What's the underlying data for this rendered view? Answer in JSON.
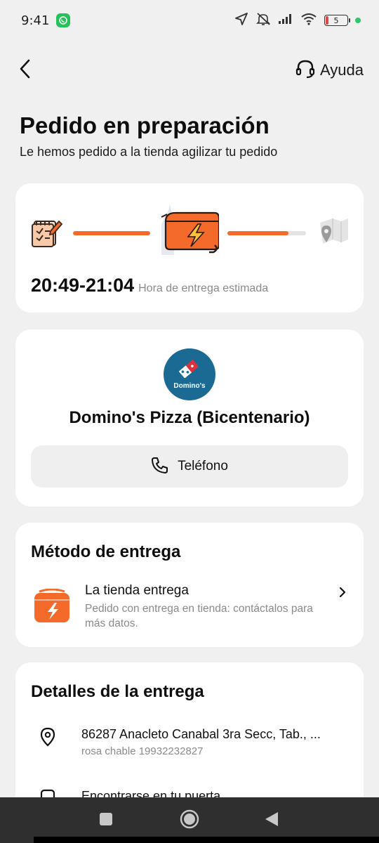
{
  "status_bar": {
    "time": "9:41",
    "battery": "5",
    "icons": [
      "whatsapp-icon",
      "location-arrow-icon",
      "mute-icon",
      "signal-icon",
      "wifi-icon",
      "battery-icon"
    ]
  },
  "header": {
    "back_icon": "chevron-left-icon",
    "help_label": "Ayuda",
    "help_icon": "headset-icon"
  },
  "title": "Pedido en preparación",
  "subtitle": "Le hemos pedido a la tienda agilizar tu pedido",
  "progress": {
    "steps": [
      "order-notepad-icon",
      "delivery-bag-icon",
      "map-pin-icon"
    ],
    "segment_1_fill": 1.0,
    "segment_2_fill": 0.78,
    "eta_time": "20:49-21:04",
    "eta_label": "Hora de entrega estimada",
    "accent": "#f36a2a"
  },
  "store": {
    "logo_text": "Domino's",
    "logo_color": "#1a6a94",
    "name": "Domino's Pizza (Bicentenario)",
    "phone_label": "Teléfono"
  },
  "delivery_method": {
    "heading": "Método de entrega",
    "title": "La tienda entrega",
    "description": "Pedido con entrega en tienda: contáctalos para más datos."
  },
  "delivery_details": {
    "heading": "Detalles de la entrega",
    "address": "86287 Anacleto Canabal 3ra Secc, Tab., ...",
    "contact": "rosa chable 19932232827",
    "meeting": "Encontrarse en tu puerta"
  },
  "nav": {
    "buttons": [
      "recents-button",
      "home-button",
      "back-button"
    ]
  }
}
